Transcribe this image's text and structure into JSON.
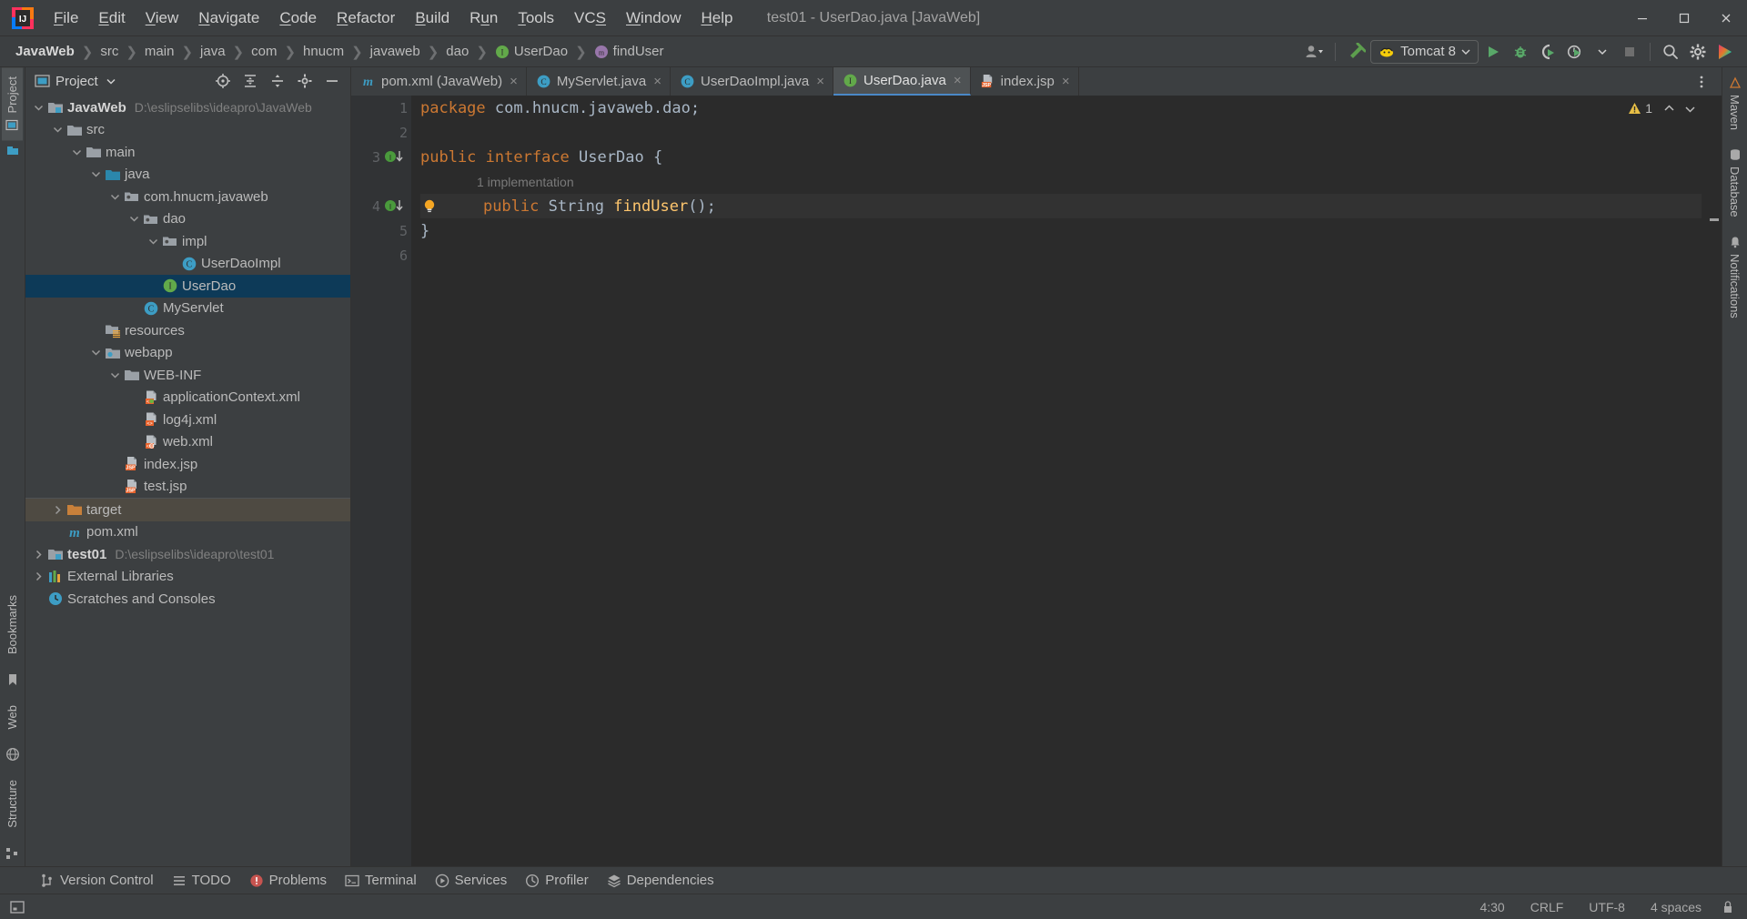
{
  "window": {
    "title": "test01 - UserDao.java [JavaWeb]",
    "minimize": "minimize-icon",
    "maximize": "maximize-icon",
    "close": "close-icon"
  },
  "menu": {
    "items": [
      {
        "label": "File",
        "mnemonic": "F"
      },
      {
        "label": "Edit",
        "mnemonic": "E"
      },
      {
        "label": "View",
        "mnemonic": "V"
      },
      {
        "label": "Navigate",
        "mnemonic": "N"
      },
      {
        "label": "Code",
        "mnemonic": "C"
      },
      {
        "label": "Refactor",
        "mnemonic": "R"
      },
      {
        "label": "Build",
        "mnemonic": "B"
      },
      {
        "label": "Run",
        "mnemonic": "u"
      },
      {
        "label": "Tools",
        "mnemonic": "T"
      },
      {
        "label": "VCS",
        "mnemonic": "S"
      },
      {
        "label": "Window",
        "mnemonic": "W"
      },
      {
        "label": "Help",
        "mnemonic": "H"
      }
    ]
  },
  "navbar": {
    "breadcrumbs": [
      {
        "label": "JavaWeb",
        "bold": true,
        "icon": null
      },
      {
        "label": "src",
        "bold": false,
        "icon": null
      },
      {
        "label": "main",
        "bold": false,
        "icon": null
      },
      {
        "label": "java",
        "bold": false,
        "icon": null
      },
      {
        "label": "com",
        "bold": false,
        "icon": null
      },
      {
        "label": "hnucm",
        "bold": false,
        "icon": null
      },
      {
        "label": "javaweb",
        "bold": false,
        "icon": null
      },
      {
        "label": "dao",
        "bold": false,
        "icon": null
      },
      {
        "label": "UserDao",
        "bold": false,
        "icon": "interface-icon"
      },
      {
        "label": "findUser",
        "bold": false,
        "icon": "method-icon"
      }
    ],
    "run_config": "Tomcat 8",
    "buttons": {
      "user_dropdown": "user-icon",
      "make_project": "hammer-icon",
      "run": "run-icon",
      "debug": "debug-icon",
      "run_coverage": "coverage-icon",
      "profiler": "profiler-icon",
      "stop": "stop-icon",
      "search": "search-icon",
      "settings": "gear-icon",
      "updates": "idea-colorful-icon"
    }
  },
  "left_strip": {
    "top_tabs": [
      {
        "label": "Project",
        "icon": "project-icon",
        "selected": true
      }
    ],
    "bottom_tabs": [
      {
        "label": "Bookmarks",
        "icon": "bookmark-icon"
      },
      {
        "label": "Web",
        "icon": "web-icon"
      },
      {
        "label": "Structure",
        "icon": "structure-icon"
      }
    ]
  },
  "right_strip": {
    "tabs": [
      {
        "label": "Maven",
        "icon": "maven-icon"
      },
      {
        "label": "Database",
        "icon": "database-icon"
      },
      {
        "label": "Notifications",
        "icon": "bell-icon"
      }
    ]
  },
  "project_panel": {
    "title": "Project",
    "toolbar": [
      {
        "name": "select-opened-file-icon"
      },
      {
        "name": "expand-all-icon"
      },
      {
        "name": "collapse-all-icon"
      },
      {
        "name": "settings-gear-icon"
      },
      {
        "name": "hide-icon"
      }
    ],
    "tree": [
      {
        "depth": 0,
        "label": "JavaWeb",
        "path": "D:\\eslipselibs\\ideapro\\JavaWeb",
        "icon": "module-icon",
        "arrow": "down",
        "bold": true,
        "state": "normal"
      },
      {
        "depth": 1,
        "label": "src",
        "path": "",
        "icon": "folder-icon",
        "arrow": "down",
        "bold": false,
        "state": "normal"
      },
      {
        "depth": 2,
        "label": "main",
        "path": "",
        "icon": "folder-icon",
        "arrow": "down",
        "bold": false,
        "state": "normal"
      },
      {
        "depth": 3,
        "label": "java",
        "path": "",
        "icon": "source-root-icon",
        "arrow": "down",
        "bold": false,
        "state": "normal"
      },
      {
        "depth": 4,
        "label": "com.hnucm.javaweb",
        "path": "",
        "icon": "package-icon",
        "arrow": "down",
        "bold": false,
        "state": "normal"
      },
      {
        "depth": 5,
        "label": "dao",
        "path": "",
        "icon": "package-icon",
        "arrow": "down",
        "bold": false,
        "state": "normal"
      },
      {
        "depth": 6,
        "label": "impl",
        "path": "",
        "icon": "package-icon",
        "arrow": "down",
        "bold": false,
        "state": "normal"
      },
      {
        "depth": 7,
        "label": "UserDaoImpl",
        "path": "",
        "icon": "class-icon",
        "arrow": "none",
        "bold": false,
        "state": "normal"
      },
      {
        "depth": 6,
        "label": "UserDao",
        "path": "",
        "icon": "interface-icon",
        "arrow": "none",
        "bold": false,
        "state": "selected"
      },
      {
        "depth": 5,
        "label": "MyServlet",
        "path": "",
        "icon": "class-icon",
        "arrow": "none",
        "bold": false,
        "state": "normal"
      },
      {
        "depth": 3,
        "label": "resources",
        "path": "",
        "icon": "resource-root-icon",
        "arrow": "none",
        "bold": false,
        "state": "normal"
      },
      {
        "depth": 3,
        "label": "webapp",
        "path": "",
        "icon": "webapp-folder-icon",
        "arrow": "down",
        "bold": false,
        "state": "normal"
      },
      {
        "depth": 4,
        "label": "WEB-INF",
        "path": "",
        "icon": "folder-icon",
        "arrow": "down",
        "bold": false,
        "state": "normal"
      },
      {
        "depth": 5,
        "label": "applicationContext.xml",
        "path": "",
        "icon": "spring-xml-icon",
        "arrow": "none",
        "bold": false,
        "state": "normal"
      },
      {
        "depth": 5,
        "label": "log4j.xml",
        "path": "",
        "icon": "xml-icon",
        "arrow": "none",
        "bold": false,
        "state": "normal"
      },
      {
        "depth": 5,
        "label": "web.xml",
        "path": "",
        "icon": "web-xml-icon",
        "arrow": "none",
        "bold": false,
        "state": "normal"
      },
      {
        "depth": 4,
        "label": "index.jsp",
        "path": "",
        "icon": "jsp-icon",
        "arrow": "none",
        "bold": false,
        "state": "normal"
      },
      {
        "depth": 4,
        "label": "test.jsp",
        "path": "",
        "icon": "jsp-icon",
        "arrow": "none",
        "bold": false,
        "state": "normal"
      },
      {
        "depth": 1,
        "label": "target",
        "path": "",
        "icon": "excluded-folder-icon",
        "arrow": "right",
        "bold": false,
        "state": "ctx"
      },
      {
        "depth": 1,
        "label": "pom.xml",
        "path": "",
        "icon": "maven-pom-icon",
        "arrow": "none",
        "bold": false,
        "state": "normal"
      },
      {
        "depth": 0,
        "label": "test01",
        "path": "D:\\eslipselibs\\ideapro\\test01",
        "icon": "module-icon",
        "arrow": "right",
        "bold": true,
        "state": "normal"
      },
      {
        "depth": 0,
        "label": "External Libraries",
        "path": "",
        "icon": "libraries-icon",
        "arrow": "right",
        "bold": false,
        "state": "normal"
      },
      {
        "depth": 0,
        "label": "Scratches and Consoles",
        "path": "",
        "icon": "scratches-icon",
        "arrow": "none",
        "bold": false,
        "state": "normal"
      }
    ]
  },
  "editor": {
    "tabs": [
      {
        "label": "pom.xml (JavaWeb)",
        "icon": "maven-pom-icon",
        "active": false
      },
      {
        "label": "MyServlet.java",
        "icon": "class-icon",
        "active": false
      },
      {
        "label": "UserDaoImpl.java",
        "icon": "class-icon",
        "active": false
      },
      {
        "label": "UserDao.java",
        "icon": "interface-icon",
        "active": true
      },
      {
        "label": "index.jsp",
        "icon": "jsp-icon",
        "active": false
      }
    ],
    "close_label": "×",
    "inspection": {
      "warnings": "1",
      "icon": "warning-icon"
    },
    "lines": [
      {
        "num": "1",
        "gutter": "none",
        "segments": [
          {
            "t": "package",
            "c": "kw"
          },
          {
            "t": " com.hnucm.javaweb.dao;",
            "c": "pl"
          }
        ]
      },
      {
        "num": "2",
        "gutter": "none",
        "segments": []
      },
      {
        "num": "3",
        "gutter": "implemented",
        "segments": [
          {
            "t": "public",
            "c": "kw"
          },
          {
            "t": " ",
            "c": "pl"
          },
          {
            "t": "interface",
            "c": "kw"
          },
          {
            "t": " ",
            "c": "pl"
          },
          {
            "t": "UserDao",
            "c": "typ"
          },
          {
            "t": " {",
            "c": "pl"
          }
        ]
      },
      {
        "num": "",
        "gutter": "inlay",
        "inlay": "1 implementation",
        "segments": []
      },
      {
        "num": "4",
        "gutter": "implemented",
        "bulb": true,
        "indent": 1,
        "segments": [
          {
            "t": "public",
            "c": "kw"
          },
          {
            "t": " ",
            "c": "pl"
          },
          {
            "t": "String",
            "c": "typ"
          },
          {
            "t": " ",
            "c": "pl"
          },
          {
            "t": "findUser",
            "c": "mth"
          },
          {
            "t": "();",
            "c": "pl"
          }
        ]
      },
      {
        "num": "5",
        "gutter": "none",
        "segments": [
          {
            "t": "}",
            "c": "pl"
          }
        ]
      },
      {
        "num": "6",
        "gutter": "none",
        "segments": []
      }
    ]
  },
  "bottom_bar": {
    "tools": [
      {
        "label": "Version Control",
        "icon": "vcs-icon"
      },
      {
        "label": "TODO",
        "icon": "todo-icon"
      },
      {
        "label": "Problems",
        "icon": "problems-icon"
      },
      {
        "label": "Terminal",
        "icon": "terminal-icon"
      },
      {
        "label": "Services",
        "icon": "services-icon"
      },
      {
        "label": "Profiler",
        "icon": "profiler-icon"
      },
      {
        "label": "Dependencies",
        "icon": "dependencies-icon"
      }
    ]
  },
  "status_bar": {
    "left_icon": "event-log-icon",
    "caret": "4:30",
    "line_separator": "CRLF",
    "encoding": "UTF-8",
    "indent": "4 spaces",
    "lock": "lock-icon",
    "memory": ""
  },
  "colors": {
    "bg": "#3c3f41",
    "editor_bg": "#2b2b2b",
    "gutter_bg": "#313335",
    "selection": "#0d3a58",
    "accent_blue": "#4a88c7",
    "keyword_orange": "#cc7832",
    "method_yellow": "#ffc66d",
    "text": "#a9b7c6",
    "interface_green": "#62a94a",
    "class_blue": "#3d9dc4"
  }
}
